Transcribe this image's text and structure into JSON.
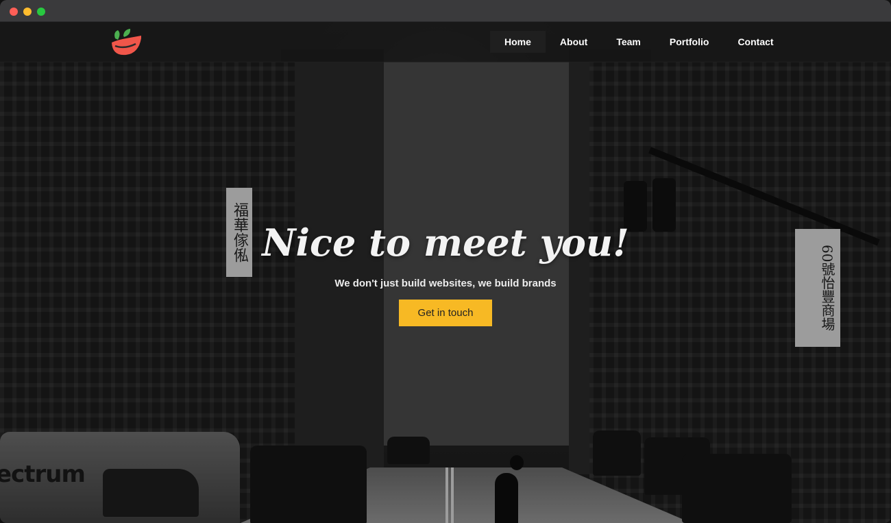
{
  "window": {
    "controls": [
      "close",
      "minimize",
      "maximize"
    ]
  },
  "brand": {
    "logo_icon": "leaf-bowl-logo",
    "logo_colors": {
      "leaf": "#4caf50",
      "bowl": "#f0564a"
    }
  },
  "nav": {
    "items": [
      {
        "label": "Home",
        "active": true
      },
      {
        "label": "About",
        "active": false
      },
      {
        "label": "Team",
        "active": false
      },
      {
        "label": "Portfolio",
        "active": false
      },
      {
        "label": "Contact",
        "active": false
      }
    ]
  },
  "hero": {
    "title": "Nice to meet you!",
    "subtitle": "We don't just build websites, we build brands",
    "cta_label": "Get in touch",
    "cta_color": "#f7b924",
    "background_image_text": {
      "van_logo": "ectrum",
      "shop_signs": [
        "福華傢俬",
        "60號怡豐商場"
      ]
    }
  }
}
